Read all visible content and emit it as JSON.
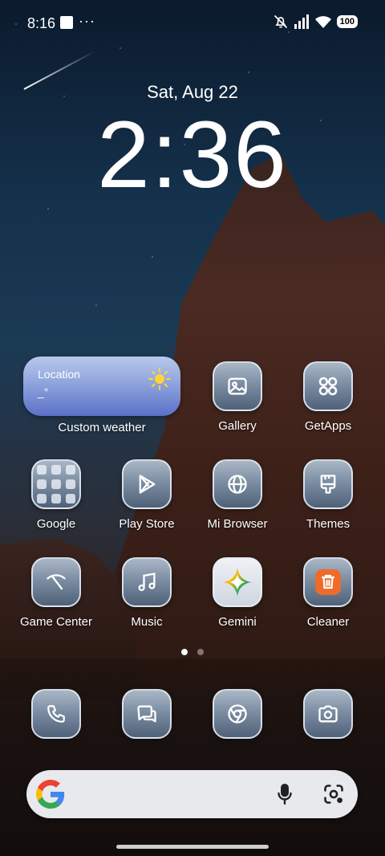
{
  "status_bar": {
    "time": "8:16",
    "more": "···",
    "battery": "100"
  },
  "lockscreen": {
    "date": "Sat, Aug 22",
    "clock": "2:36"
  },
  "weather_widget": {
    "location": "Location",
    "temperature": "_°",
    "label": "Custom weather"
  },
  "apps": [
    {
      "label": "Gallery",
      "icon": "gallery-icon"
    },
    {
      "label": "GetApps",
      "icon": "getapps-icon"
    },
    {
      "label": "Google",
      "icon": "google-folder-icon"
    },
    {
      "label": "Play Store",
      "icon": "play-store-icon"
    },
    {
      "label": "Mi Browser",
      "icon": "globe-icon"
    },
    {
      "label": "Themes",
      "icon": "brush-icon"
    },
    {
      "label": "Game Center",
      "icon": "game-center-icon"
    },
    {
      "label": "Music",
      "icon": "music-note-icon"
    },
    {
      "label": "Gemini",
      "icon": "gemini-icon"
    },
    {
      "label": "Cleaner",
      "icon": "trash-icon"
    }
  ],
  "dock": [
    {
      "icon": "phone-icon"
    },
    {
      "icon": "messages-icon"
    },
    {
      "icon": "chrome-icon"
    },
    {
      "icon": "camera-icon"
    }
  ],
  "page_indicator": {
    "pages": 2,
    "active": 1
  },
  "colors": {
    "icon_gradient_top": "#a9b6c6",
    "icon_gradient_bottom": "#4f6178",
    "cleaner_orange": "#f06a2a",
    "search_bg": "#e8e9ed"
  }
}
